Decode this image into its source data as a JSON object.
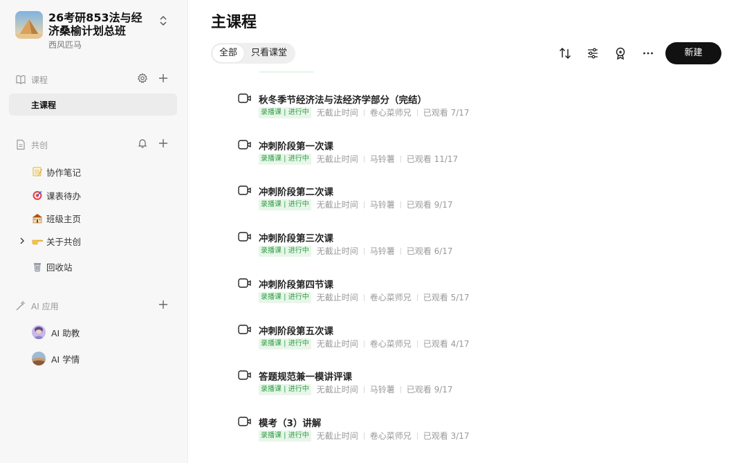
{
  "sidebar": {
    "class_title_line1": "26考研853法与经",
    "class_title_line2": "济桑榆计划总班",
    "class_owner": "西风匹马",
    "course_section_label": "课程",
    "active_course": "主课程",
    "cocreate_section_label": "共创",
    "cocreate_items": [
      {
        "label": "协作笔记",
        "icon": "memo-icon"
      },
      {
        "label": "课表待办",
        "icon": "target-icon"
      },
      {
        "label": "班级主页",
        "icon": "school-icon"
      },
      {
        "label": "关于共创",
        "icon": "pointing-hand-icon"
      }
    ],
    "recycle_label": "回收站",
    "ai_section_label": "AI 应用",
    "ai_items": [
      {
        "label": "AI 助教"
      },
      {
        "label": "AI 学情"
      }
    ]
  },
  "main": {
    "title": "主课程",
    "filters": [
      "全部",
      "只看课堂"
    ],
    "new_button": "新建",
    "courses": [
      {
        "title": "秋冬季节经济法与法经济学部分（完结）",
        "badge": "录播课 | 进行中",
        "deadline": "无截止时间",
        "teacher": "卷心菜师兄",
        "progress": "已观看 7/17"
      },
      {
        "title": "冲刺阶段第一次课",
        "badge": "录播课 | 进行中",
        "deadline": "无截止时间",
        "teacher": "马铃薯",
        "progress": "已观看 11/17"
      },
      {
        "title": "冲刺阶段第二次课",
        "badge": "录播课 | 进行中",
        "deadline": "无截止时间",
        "teacher": "马铃薯",
        "progress": "已观看 9/17"
      },
      {
        "title": "冲刺阶段第三次课",
        "badge": "录播课 | 进行中",
        "deadline": "无截止时间",
        "teacher": "马铃薯",
        "progress": "已观看 6/17"
      },
      {
        "title": "冲刺阶段第四节课",
        "badge": "录播课 | 进行中",
        "deadline": "无截止时间",
        "teacher": "卷心菜师兄",
        "progress": "已观看 5/17"
      },
      {
        "title": "冲刺阶段第五次课",
        "badge": "录播课 | 进行中",
        "deadline": "无截止时间",
        "teacher": "卷心菜师兄",
        "progress": "已观看 4/17"
      },
      {
        "title": "答题规范兼一模讲评课",
        "badge": "录播课 | 进行中",
        "deadline": "无截止时间",
        "teacher": "马铃薯",
        "progress": "已观看 9/17"
      },
      {
        "title": "模考（3）讲解",
        "badge": "录播课 | 进行中",
        "deadline": "无截止时间",
        "teacher": "卷心菜师兄",
        "progress": "已观看 3/17"
      }
    ]
  },
  "colors": {
    "accent_dark": "#111111",
    "badge_bg": "#e8f6ea",
    "badge_text": "#2f9e44",
    "sidebar_bg": "#f7f7f7"
  }
}
